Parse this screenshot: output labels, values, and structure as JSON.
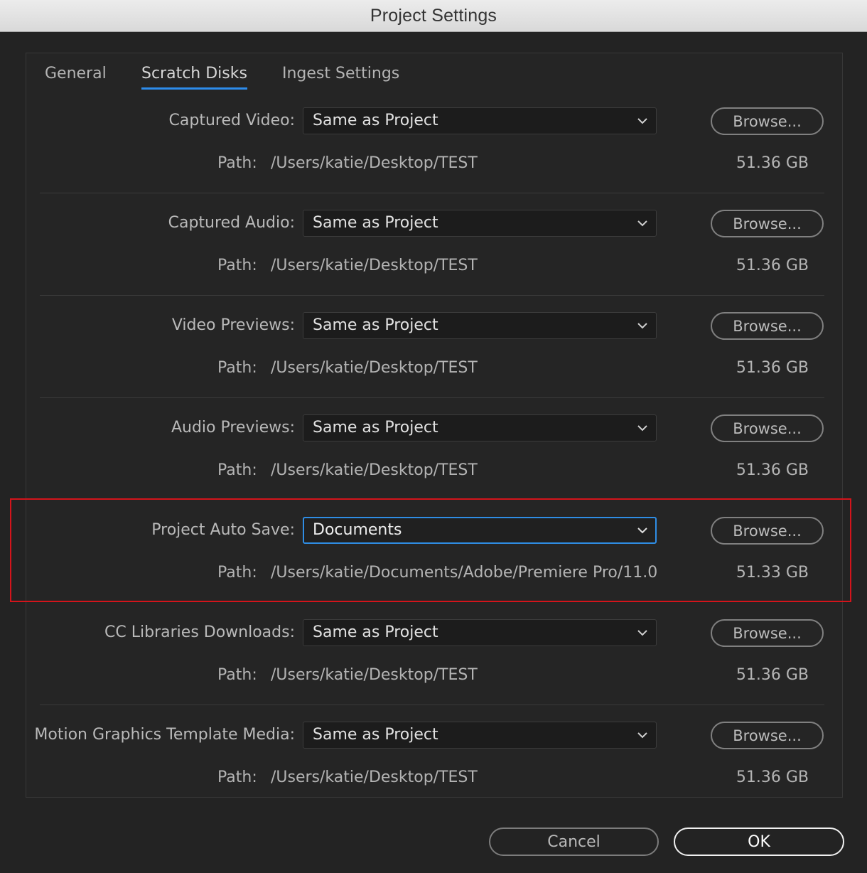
{
  "window": {
    "title": "Project Settings"
  },
  "tabs": [
    {
      "label": "General",
      "active": false
    },
    {
      "label": "Scratch Disks",
      "active": true
    },
    {
      "label": "Ingest Settings",
      "active": false
    }
  ],
  "path_label": "Path:",
  "browse_label": "Browse...",
  "rows": [
    {
      "label": "Captured Video:",
      "value": "Same as Project",
      "path": "/Users/katie/Desktop/TEST",
      "size": "51.36 GB"
    },
    {
      "label": "Captured Audio:",
      "value": "Same as Project",
      "path": "/Users/katie/Desktop/TEST",
      "size": "51.36 GB"
    },
    {
      "label": "Video Previews:",
      "value": "Same as Project",
      "path": "/Users/katie/Desktop/TEST",
      "size": "51.36 GB"
    },
    {
      "label": "Audio Previews:",
      "value": "Same as Project",
      "path": "/Users/katie/Desktop/TEST",
      "size": "51.36 GB"
    },
    {
      "label": "Project Auto Save:",
      "value": "Documents",
      "path": "/Users/katie/Documents/Adobe/Premiere Pro/11.0",
      "size": "51.33 GB",
      "focused": true
    },
    {
      "label": "CC Libraries Downloads:",
      "value": "Same as Project",
      "path": "/Users/katie/Desktop/TEST",
      "size": "51.36 GB"
    },
    {
      "label": "Motion Graphics Template Media:",
      "value": "Same as Project",
      "path": "/Users/katie/Desktop/TEST",
      "size": "51.36 GB"
    }
  ],
  "footer": {
    "cancel_label": "Cancel",
    "ok_label": "OK"
  },
  "colors": {
    "accent": "#2f8de4",
    "highlight": "#d4141b"
  },
  "icons": {
    "dropdown": "chevron-down-icon"
  }
}
